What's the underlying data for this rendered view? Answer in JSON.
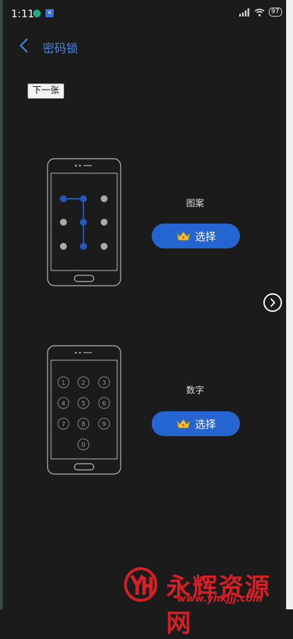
{
  "status_bar": {
    "time": "1:11",
    "battery": "97",
    "icons": [
      "notification-dot-icon",
      "app-badge-icon",
      "hd-signal-icon",
      "wifi-icon",
      "battery-icon"
    ]
  },
  "header": {
    "title": "密码锁",
    "back_icon": "chevron-left-icon"
  },
  "tooltip": {
    "next_label": "下一张"
  },
  "options": [
    {
      "label": "图案",
      "button_label": "选择",
      "badge_icon": "crown-icon"
    },
    {
      "label": "数字",
      "button_label": "选择",
      "badge_icon": "crown-icon"
    }
  ],
  "keypad_digits": [
    "1",
    "2",
    "3",
    "4",
    "5",
    "6",
    "7",
    "8",
    "9",
    "0"
  ],
  "nav_arrow_icon": "chevron-right-circle-icon",
  "watermark": {
    "text": "永辉资源网",
    "url": "www.yhkjjj.com"
  },
  "colors": {
    "accent": "#2565d1",
    "title": "#4a84e3",
    "pattern_dot": "#2456c4",
    "watermark": "#d91f26"
  }
}
